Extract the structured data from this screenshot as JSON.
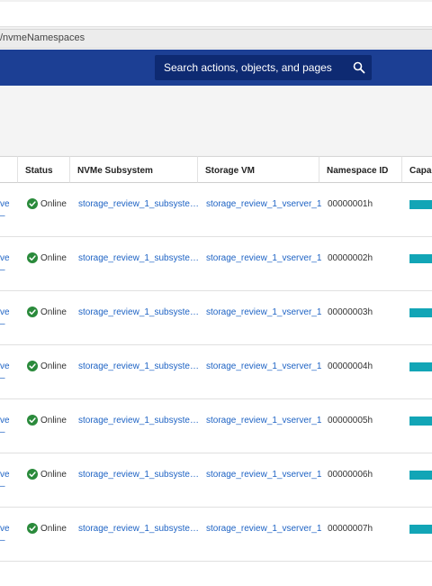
{
  "browser": {
    "url_fragment": "/nvmeNamespaces"
  },
  "header": {
    "search_placeholder": "Search actions, objects, and pages"
  },
  "table": {
    "columns": {
      "status": "Status",
      "subsystem": "NVMe Subsystem",
      "storage_vm": "Storage VM",
      "namespace_id": "Namespace ID",
      "capacity": "Capac"
    },
    "rows": [
      {
        "name_stub": "ve",
        "name_stub2": "–",
        "status": "Online",
        "subsystem": "storage_review_1_subsyste…",
        "storage_vm": "storage_review_1_vserver_1",
        "namespace_id": "00000001h"
      },
      {
        "name_stub": "ve",
        "name_stub2": "–",
        "status": "Online",
        "subsystem": "storage_review_1_subsyste…",
        "storage_vm": "storage_review_1_vserver_1",
        "namespace_id": "00000002h"
      },
      {
        "name_stub": "ve",
        "name_stub2": "–",
        "status": "Online",
        "subsystem": "storage_review_1_subsyste…",
        "storage_vm": "storage_review_1_vserver_1",
        "namespace_id": "00000003h"
      },
      {
        "name_stub": "ve",
        "name_stub2": "–",
        "status": "Online",
        "subsystem": "storage_review_1_subsyste…",
        "storage_vm": "storage_review_1_vserver_1",
        "namespace_id": "00000004h"
      },
      {
        "name_stub": "ve",
        "name_stub2": "–",
        "status": "Online",
        "subsystem": "storage_review_1_subsyste…",
        "storage_vm": "storage_review_1_vserver_1",
        "namespace_id": "00000005h"
      },
      {
        "name_stub": "ve",
        "name_stub2": "–",
        "status": "Online",
        "subsystem": "storage_review_1_subsyste…",
        "storage_vm": "storage_review_1_vserver_1",
        "namespace_id": "00000006h"
      },
      {
        "name_stub": "ve",
        "name_stub2": "–",
        "status": "Online",
        "subsystem": "storage_review_1_subsyste…",
        "storage_vm": "storage_review_1_vserver_1",
        "namespace_id": "00000007h"
      }
    ]
  },
  "colors": {
    "header_bg": "#1c3f94",
    "link": "#1e63c4",
    "ok_green": "#2a8a3b",
    "capacity_bar": "#12a5b6"
  },
  "icons": {
    "search": "search-icon",
    "status_ok": "check-circle-icon"
  }
}
